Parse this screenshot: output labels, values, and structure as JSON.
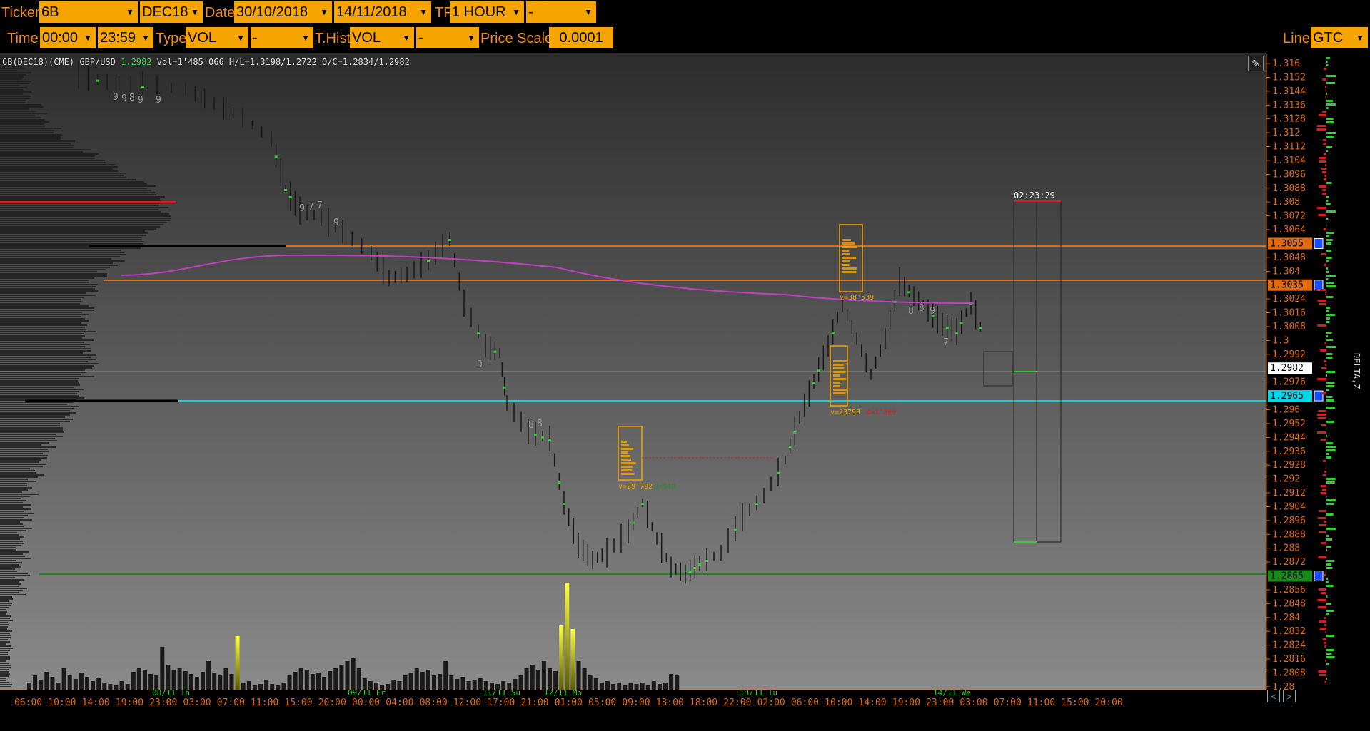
{
  "toolbar": {
    "ticker_label": "Ticker",
    "ticker_value": "6B",
    "contract_value": "DEC18",
    "date_label": "Date",
    "date_from": "30/10/2018",
    "date_to": "14/11/2018",
    "tf_label": "TF",
    "tf_value": "1 HOUR",
    "tf_extra": "-",
    "time_label": "Time",
    "time_from": "00:00",
    "time_to": "23:59",
    "type_label": "Type",
    "type_value": "VOL",
    "type_extra": "-",
    "thist_label": "T.Hist",
    "thist_value": "VOL",
    "thist_extra": "-",
    "price_scale_label": "Price Scale",
    "price_scale_value": "0.0001",
    "line_label": "Line",
    "line_value": "GTC"
  },
  "info_bar": {
    "symbol": "6B(DEC18)(CME) GBP/USD",
    "last": "1.2982",
    "stats": "Vol=1'485'066  H/L=1.3198/1.2722  O/C=1.2834/1.2982"
  },
  "side_label": "DELTA,Z",
  "countdown": "02:23:29",
  "price_axis": [
    "1.316",
    "1.3152",
    "1.3144",
    "1.3136",
    "1.3128",
    "1.312",
    "1.3112",
    "1.3104",
    "1.3096",
    "1.3088",
    "1.308",
    "1.3072",
    "1.3064",
    "1.3055",
    "1.3048",
    "1.304",
    "1.3035",
    "1.3024",
    "1.3016",
    "1.3008",
    "1.3",
    "1.2992",
    "1.2982",
    "1.2976",
    "1.2965",
    "1.296",
    "1.2952",
    "1.2944",
    "1.2936",
    "1.2928",
    "1.292",
    "1.2912",
    "1.2904",
    "1.2896",
    "1.2888",
    "1.288",
    "1.2872",
    "1.2865",
    "1.2856",
    "1.2848",
    "1.284",
    "1.2832",
    "1.2824",
    "1.2816",
    "1.2808",
    "1.28"
  ],
  "price_tags": [
    {
      "value": "1.3055",
      "color": "#e06a10",
      "text_color": "#000"
    },
    {
      "value": "1.3035",
      "color": "#e06a10",
      "text_color": "#000"
    },
    {
      "value": "1.2982",
      "color": "#ffffff",
      "text_color": "#000"
    },
    {
      "value": "1.2965",
      "color": "#00d8e8",
      "text_color": "#000"
    },
    {
      "value": "1.2865",
      "color": "#1a8a1a",
      "text_color": "#000"
    }
  ],
  "time_axis": [
    "06:00",
    "10:00",
    "14:00",
    "19:00",
    "23:00",
    "03:00",
    "07:00",
    "11:00",
    "15:00",
    "20:00",
    "00:00",
    "04:00",
    "08:00",
    "12:00",
    "17:00",
    "21:00",
    "01:00",
    "05:00",
    "09:00",
    "13:00",
    "18:00",
    "22:00",
    "02:00",
    "06:00",
    "10:00",
    "14:00",
    "19:00",
    "23:00",
    "03:00",
    "07:00",
    "11:00",
    "15:00",
    "20:00"
  ],
  "day_labels": [
    "08/11 Th",
    "09/11 Fr",
    "11/11 Su",
    "12/11 Mo",
    "13/11 Tu",
    "14/11 We"
  ],
  "annotations": [
    {
      "text": "v=38'539",
      "color": "#f6a400"
    },
    {
      "text": "v=23793",
      "color": "#f6a400"
    },
    {
      "text": "d=1'389",
      "color": "#d02020"
    },
    {
      "text": "v=29'792",
      "color": "#f6a400"
    },
    {
      "text": "d=940",
      "color": "#2a8a2a"
    }
  ],
  "tpo_digits": [
    "9",
    "9",
    "8",
    "9",
    "9",
    "9",
    "7",
    "7",
    "9",
    "9",
    "8",
    "8",
    "8",
    "8",
    "9",
    "7"
  ],
  "colors": {
    "accent": "#f6a400",
    "label": "#f08a1e",
    "bg_top": "#2c2c2c",
    "bg_bottom": "#8a8a8a",
    "vwap": "#c040c0"
  }
}
